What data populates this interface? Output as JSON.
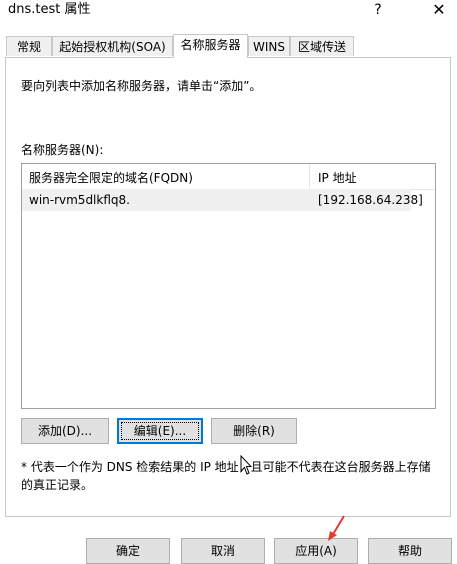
{
  "window": {
    "title": "dns.test 属性",
    "help_glyph": "?",
    "close_glyph": "✕"
  },
  "tabs": [
    {
      "label": "常规"
    },
    {
      "label": "起始授权机构(SOA)"
    },
    {
      "label": "名称服务器"
    },
    {
      "label": "WINS"
    },
    {
      "label": "区域传送"
    }
  ],
  "panel": {
    "instruction": "要向列表中添加名称服务器，请单击“添加”。",
    "list_label": "名称服务器(N):",
    "columns": [
      "服务器完全限定的域名(FQDN)",
      "IP 地址"
    ],
    "rows": [
      {
        "fqdn": "win-rvm5dlkflq8.",
        "ip": "[192.168.64.238]"
      }
    ],
    "buttons": {
      "add": "添加(D)...",
      "edit": "编辑(E)...",
      "remove": "删除(R)"
    },
    "note": "* 代表一个作为 DNS 检索结果的 IP 地址，且可能不代表在这台服务器上存储的真正记录。"
  },
  "footer": {
    "ok": "确定",
    "cancel": "取消",
    "apply": "应用(A)",
    "help": "帮助"
  },
  "colors": {
    "focus_border": "#0078d7",
    "annotation_arrow": "#e53935"
  }
}
